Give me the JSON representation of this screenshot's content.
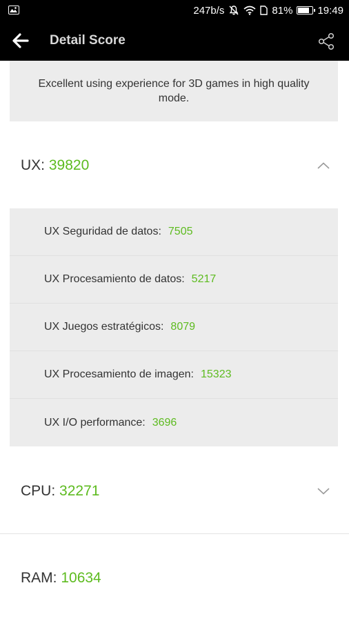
{
  "status_bar": {
    "speed": "247b/s",
    "battery": "81%",
    "battery_level": 0.81,
    "time": "19:49"
  },
  "app_bar": {
    "title": "Detail Score"
  },
  "description": "Excellent using experience for 3D games in high quality mode.",
  "sections": {
    "ux": {
      "label": "UX:",
      "value": "39820",
      "expanded": true,
      "items": [
        {
          "label": "UX Seguridad de datos:",
          "value": "7505"
        },
        {
          "label": "UX Procesamiento de datos:",
          "value": "5217"
        },
        {
          "label": "UX Juegos estratégicos:",
          "value": "8079"
        },
        {
          "label": "UX Procesamiento de imagen:",
          "value": "15323"
        },
        {
          "label": "UX I/O performance:",
          "value": "3696"
        }
      ]
    },
    "cpu": {
      "label": "CPU:",
      "value": "32271",
      "expanded": false
    },
    "ram": {
      "label": "RAM:",
      "value": "10634"
    }
  },
  "colors": {
    "accent_green": "#5dbb1f",
    "app_bar_bg": "#000000",
    "card_bg": "#ececec"
  },
  "icons": {
    "back": "arrow-left-icon",
    "share": "share-icon",
    "chevron_up": "chevron-up-icon",
    "chevron_down": "chevron-down-icon"
  }
}
